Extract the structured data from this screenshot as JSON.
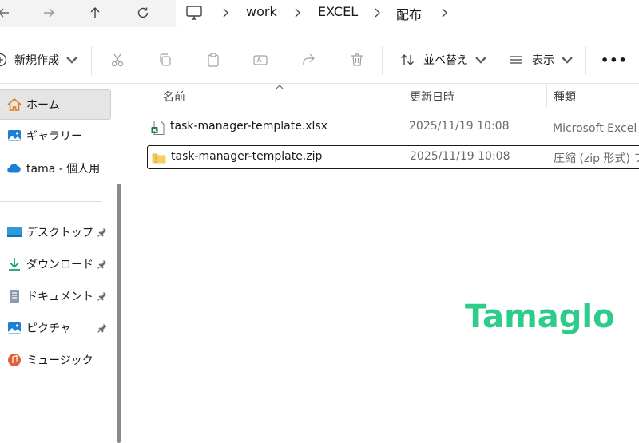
{
  "breadcrumb": {
    "items": [
      "work",
      "EXCEL",
      "配布"
    ]
  },
  "command_bar": {
    "new_label": "新規作成",
    "sort_label": "並べ替え",
    "view_label": "表示",
    "more_label": "•••"
  },
  "sidebar": {
    "items": [
      {
        "label": "ホーム",
        "icon": "home-icon",
        "selected": true
      },
      {
        "label": "ギャラリー",
        "icon": "gallery-icon"
      },
      {
        "label": "tama - 個人用",
        "icon": "onedrive-cloud-icon"
      },
      {
        "label": "デスクトップ",
        "icon": "desktop-folder-icon",
        "pinned": true
      },
      {
        "label": "ダウンロード",
        "icon": "download-icon",
        "pinned": true
      },
      {
        "label": "ドキュメント",
        "icon": "documents-icon",
        "pinned": true
      },
      {
        "label": "ピクチャ",
        "icon": "pictures-icon",
        "pinned": true
      },
      {
        "label": "ミュージック",
        "icon": "music-icon",
        "pinned": true
      }
    ]
  },
  "file_list": {
    "columns": [
      "名前",
      "更新日時",
      "種類"
    ],
    "rows": [
      {
        "name": "task-manager-template.xlsx",
        "modified": "2025/11/19 10:08",
        "type": "Microsoft Excel ワ",
        "icon": "excel-file-icon",
        "selected": false
      },
      {
        "name": "task-manager-template.zip",
        "modified": "2025/11/19 10:08",
        "type": "圧縮 (zip 形式) フ",
        "icon": "zip-folder-icon",
        "selected": true
      }
    ]
  },
  "watermark": {
    "text": "Tamaglo"
  },
  "colors": {
    "accent": "#0067c0",
    "watermark": "#2ecc8a",
    "selection_bg": "#e5e5e5"
  }
}
